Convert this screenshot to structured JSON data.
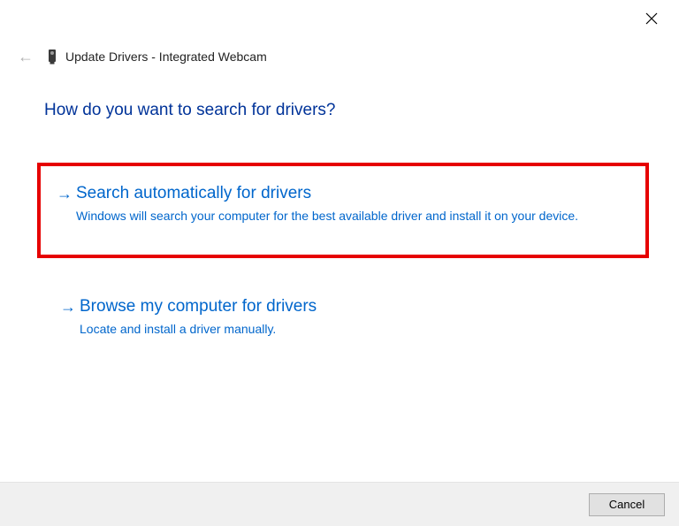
{
  "window": {
    "breadcrumb": "Update Drivers - Integrated Webcam"
  },
  "heading": "How do you want to search for drivers?",
  "options": [
    {
      "title": "Search automatically for drivers",
      "desc": "Windows will search your computer for the best available driver and install it on your device."
    },
    {
      "title": "Browse my computer for drivers",
      "desc": "Locate and install a driver manually."
    }
  ],
  "footer": {
    "cancel": "Cancel"
  }
}
